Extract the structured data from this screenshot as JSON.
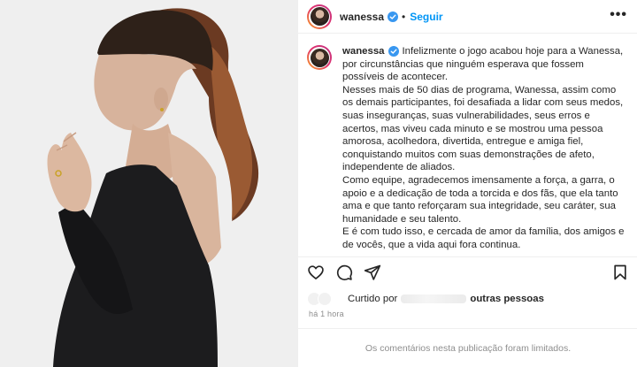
{
  "photo": {
    "alt_icon": "portrait-photo"
  },
  "header": {
    "username": "wanessa",
    "separator": "•",
    "follow_label": "Seguir",
    "more_label": "•••"
  },
  "caption": {
    "username": "wanessa",
    "paragraphs": [
      "Infelizmente o jogo acabou hoje para a Wanessa, por circunstâncias que ninguém esperava que fossem possíveis de acontecer.",
      "Nesses mais de 50 dias de programa, Wanessa, assim como os demais participantes, foi desafiada a lidar com seus medos, suas inseguranças, suas vulnerabilidades, seus erros e acertos, mas viveu cada minuto e se mostrou uma pessoa amorosa, acolhedora, divertida, entregue e amiga fiel, conquistando muitos com suas demonstrações de afeto, independente de aliados.",
      "Como equipe, agradecemos imensamente a força, a garra, o apoio e a dedicação de toda a torcida e dos fãs, que ela tanto ama e que tanto reforçaram sua integridade, seu caráter, sua humanidade e seu talento.",
      "E é com tudo isso, e cercada de amor da família, dos amigos e de vocês, que a vida aqui fora continua."
    ]
  },
  "actions": {
    "like_icon": "heart-icon",
    "comment_icon": "comment-icon",
    "share_icon": "share-icon",
    "save_icon": "bookmark-icon"
  },
  "likes": {
    "prefix": "Curtido por",
    "suffix": "outras pessoas"
  },
  "time": "há 1 hora",
  "footer": {
    "limited_text": "Os comentários nesta publicação foram limitados."
  },
  "colors": {
    "follow": "#0095f6",
    "verified": "#3897f0",
    "muted": "#8e8e8e"
  }
}
